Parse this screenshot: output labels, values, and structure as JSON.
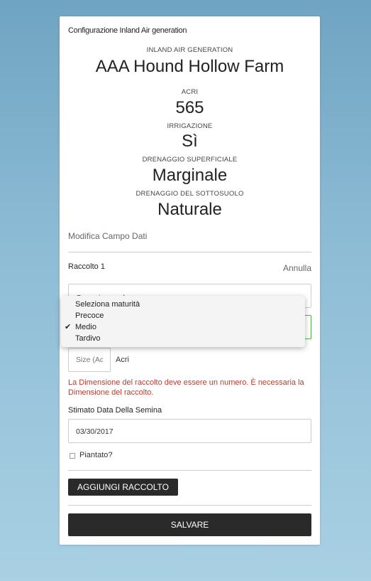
{
  "card": {
    "title": "Configurazione Inland Air generation",
    "farm_label": "INLAND AIR GENERATION",
    "farm_name": "AAA Hound Hollow Farm",
    "acres_label": "ACRI",
    "acres_value": "565",
    "irrigation_label": "IRRIGAZIONE",
    "irrigation_value": "Sì",
    "surface_drainage_label": "DRENAGGIO SUPERFICIALE",
    "surface_drainage_value": "Marginale",
    "subsoil_drainage_label": "DRENAGGIO DEL SOTTOSUOLO",
    "subsoil_drainage_value": "Naturale",
    "edit_link": "Modifica Campo Dati"
  },
  "crop": {
    "title": "Raccolto 1",
    "cancel_label": "Annulla",
    "crop_select_value": "Grano invernale",
    "maturity_options": [
      "Seleziona maturità",
      "Precoce",
      "Medio",
      "Tardivo"
    ],
    "maturity_selected": "Medio",
    "size_placeholder": "Size (Acri)",
    "size_unit": "Acri",
    "error_text": "La Dimensione del raccolto deve essere un numero. È necessaria la Dimensione del raccolto.",
    "sow_date_label": "Stimato Data Della Semina",
    "sow_date_value": "03/30/2017",
    "planted_label": "Piantato?"
  },
  "actions": {
    "add_crop_label": "AGGIUNGI RACCOLTO",
    "save_label": "SALVARE"
  },
  "colors": {
    "error": "#c0392b",
    "button_dark": "#2a2a2a",
    "focus_green": "#4cae4c"
  }
}
